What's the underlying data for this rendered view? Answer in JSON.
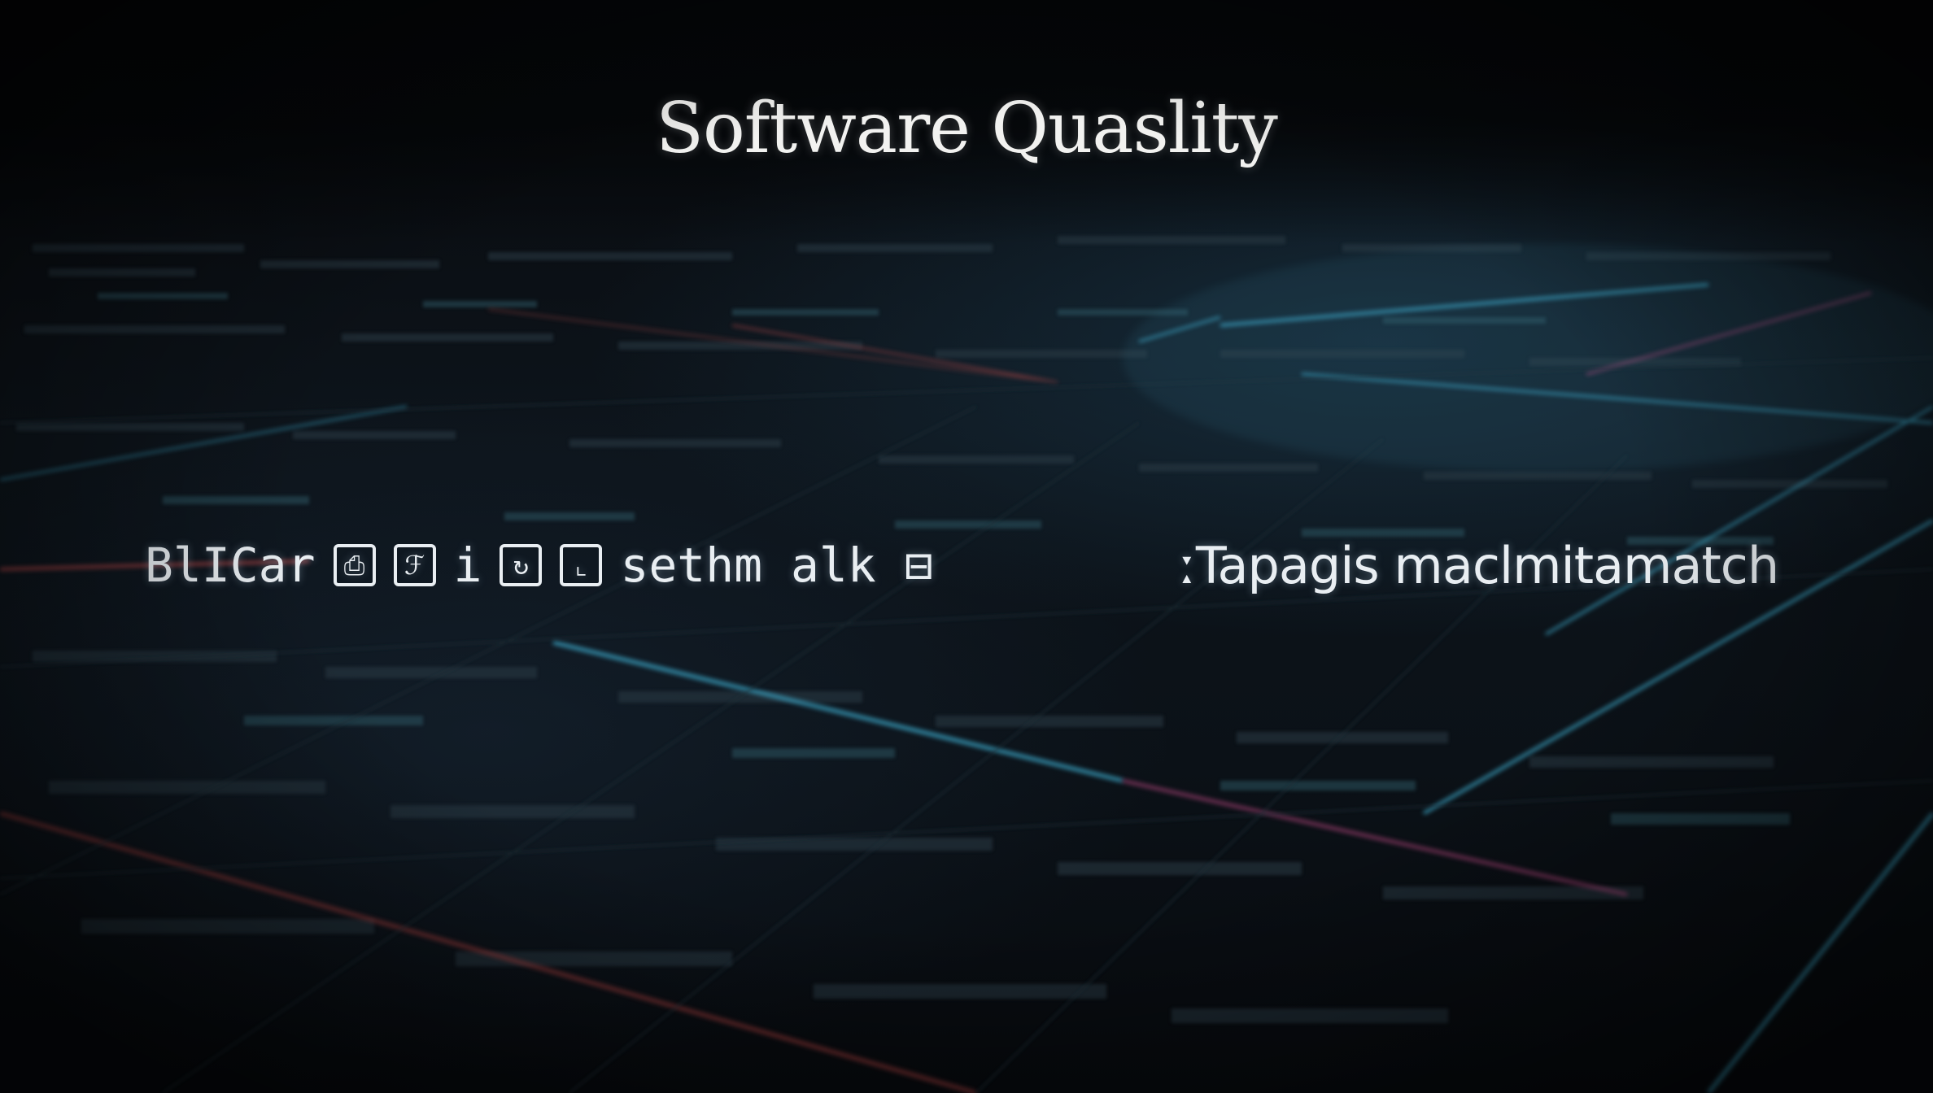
{
  "scene": {
    "title": "Software Quaslity",
    "caption_left": {
      "lead": "BlICar",
      "glyphs": [
        "⎙",
        "ℱ",
        "i",
        "↻",
        "⌞"
      ],
      "tail": "sethm alk ⊟"
    },
    "caption_right": "ːTapagis maclmitamatch"
  },
  "colors": {
    "background": "#07090c",
    "text": "#e9eef2",
    "cyan_line": "#3fb3d6",
    "red_line": "#c24a4a",
    "magenta_line": "#b0457a"
  },
  "icons": [
    "square-glyph-icon",
    "script-glyph-icon",
    "refresh-glyph-icon",
    "corner-glyph-icon"
  ]
}
